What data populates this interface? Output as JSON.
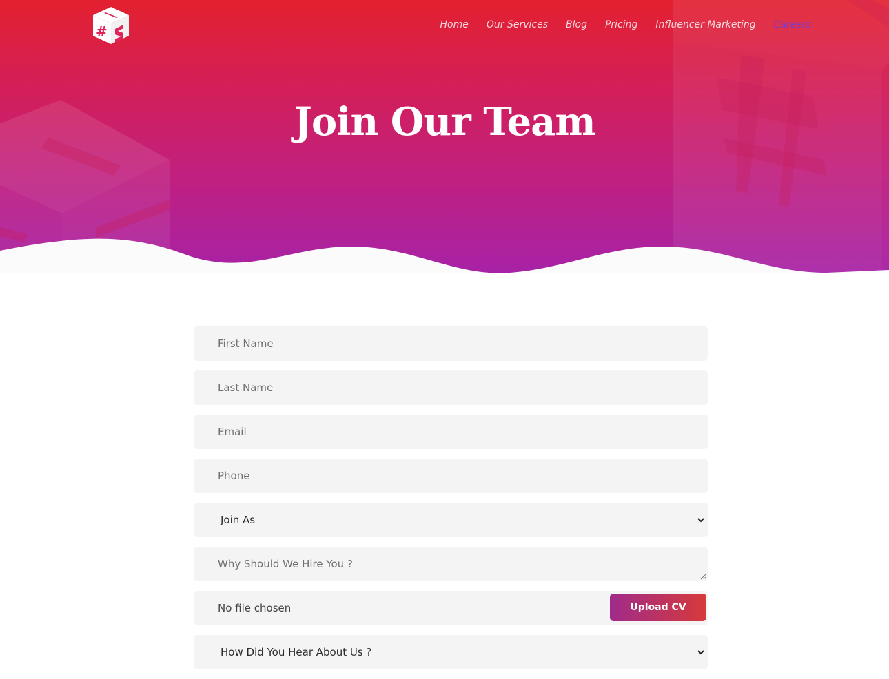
{
  "nav": {
    "items": [
      {
        "label": "Home"
      },
      {
        "label": "Our Services"
      },
      {
        "label": "Blog"
      },
      {
        "label": "Pricing"
      },
      {
        "label": "Influencer Marketing"
      },
      {
        "label": "Careers",
        "active": true
      }
    ]
  },
  "hero": {
    "title": "Join Our Team"
  },
  "logo": {
    "glyph": "#"
  },
  "form": {
    "first_name_placeholder": "First Name",
    "last_name_placeholder": "Last Name",
    "email_placeholder": "Email",
    "phone_placeholder": "Phone",
    "join_as": "Join As",
    "hire_placeholder": "Why Should We Hire You ?",
    "file_status": "No file chosen",
    "upload_label": "Upload CV",
    "hear_about": "How Did You Hear About Us ?"
  },
  "colors": {
    "hero_top": "#e3202f",
    "hero_bottom": "#a722a6",
    "active_nav": "#7a3ccf",
    "field_bg": "#f4f4f4"
  }
}
